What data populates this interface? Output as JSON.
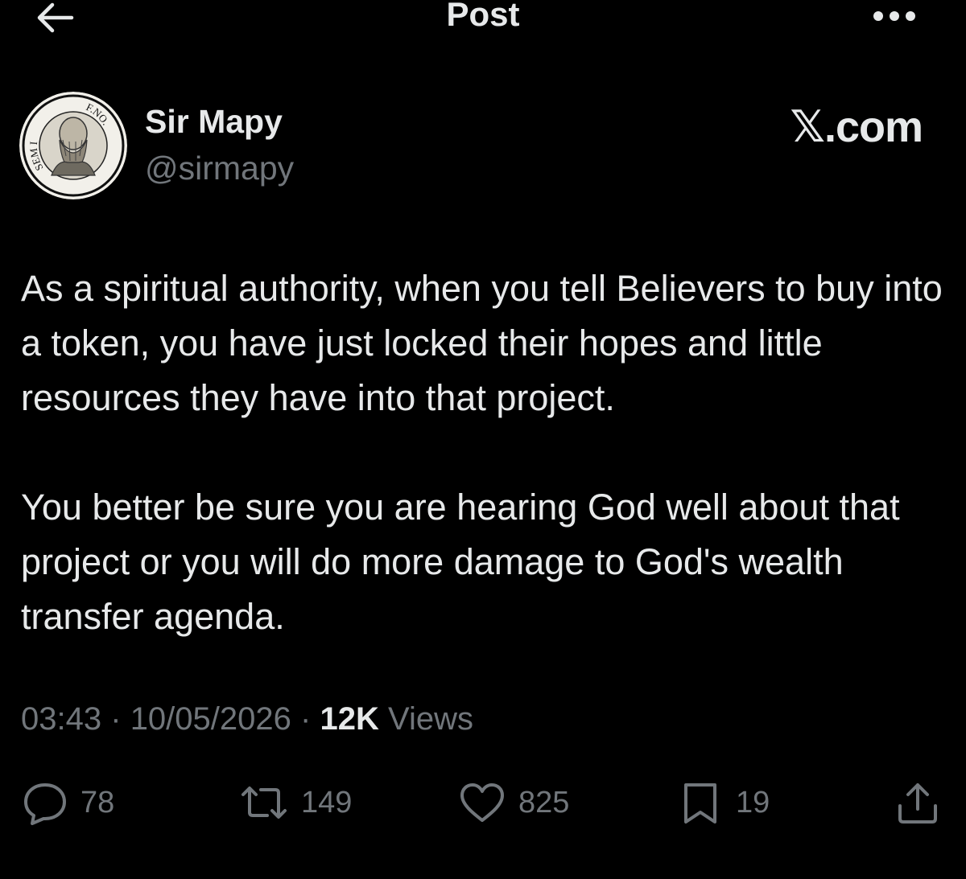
{
  "header": {
    "title": "Post"
  },
  "author": {
    "display_name": "Sir Mapy",
    "handle": "@sirmapy",
    "avatar_text_left": "SEM I",
    "avatar_text_right": "F.NO."
  },
  "watermark": "𝕏.com",
  "post": {
    "paragraphs": [
      "As a spiritual authority, when you tell Believers to buy into a token, you have just locked their hopes and little resources they have into that project.",
      "You better be sure you are hearing God well about that project or you will do more damage to God's wealth transfer agenda."
    ],
    "time": "03:43",
    "date": "10/05/2026",
    "separator": "·",
    "views_count": "12K",
    "views_label": "Views"
  },
  "actions": {
    "replies": "78",
    "reposts": "149",
    "likes": "825",
    "bookmarks": "19"
  },
  "colors": {
    "background": "#000000",
    "text": "#e7e9ea",
    "secondary": "#71767b"
  },
  "icons": [
    "back-arrow-icon",
    "more-icon",
    "reply-icon",
    "repost-icon",
    "like-icon",
    "bookmark-icon",
    "share-icon"
  ]
}
